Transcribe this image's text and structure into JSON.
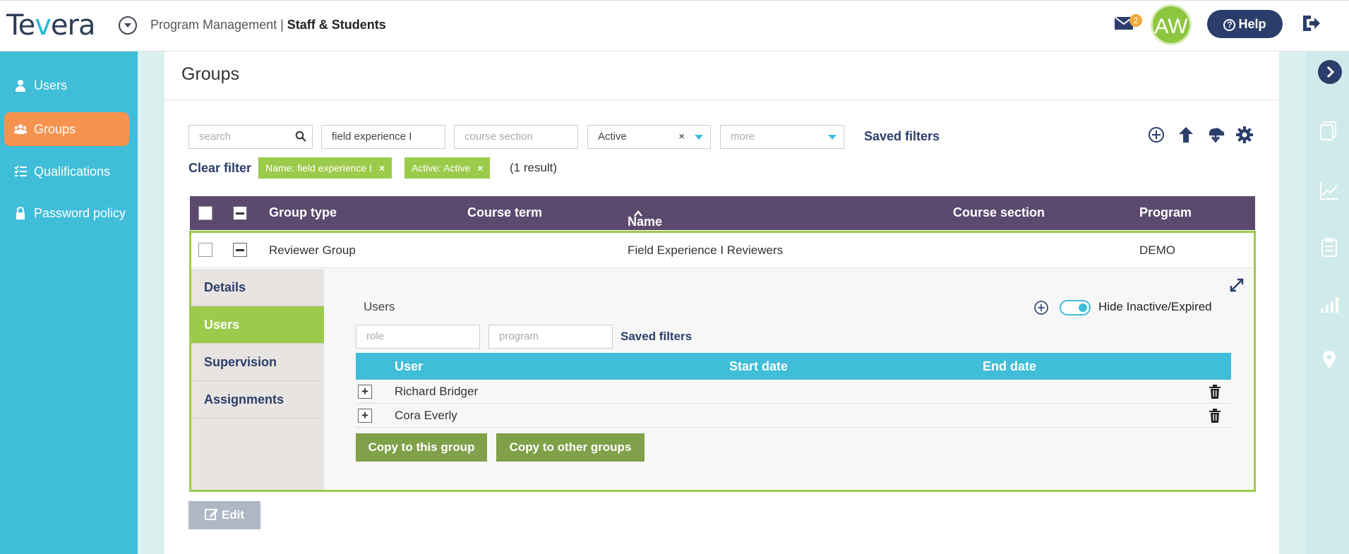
{
  "header": {
    "logo_text_a": "Te",
    "logo_text_v": "v",
    "logo_text_b": "era",
    "breadcrumb_module": "Program Management |",
    "breadcrumb_page": "Staff & Students",
    "mail_count": "2",
    "avatar_initials": "AW",
    "help_label": "Help",
    "help_icon_glyph": "?"
  },
  "sidebar": {
    "items": [
      {
        "label": "Users",
        "icon": "user-icon"
      },
      {
        "label": "Groups",
        "icon": "group-icon",
        "active": true
      },
      {
        "label": "Qualifications",
        "icon": "checklist-icon"
      },
      {
        "label": "Password policy",
        "icon": "lock-icon"
      }
    ]
  },
  "main": {
    "title": "Groups",
    "filters": {
      "search_placeholder": "search",
      "name_value": "field experience I",
      "course_section_placeholder": "course section",
      "status_value": "Active",
      "status_clear": "×",
      "more_placeholder": "more",
      "saved_filters": "Saved filters"
    },
    "clear_filter": "Clear filter",
    "chips": [
      {
        "label": "Name: field experience I"
      },
      {
        "label": "Active: Active"
      }
    ],
    "chip_close": "×",
    "result_count": "(1 result)",
    "table": {
      "columns": [
        "Group type",
        "Course term",
        "Name",
        "Course section",
        "Program"
      ],
      "rows": [
        {
          "group_type": "Reviewer Group",
          "course_term": "",
          "name": "Field Experience I Reviewers",
          "course_section": "",
          "program": "DEMO"
        }
      ]
    },
    "detail": {
      "tabs": [
        "Details",
        "Users",
        "Supervision",
        "Assignments"
      ],
      "active_tab": "Users",
      "users_title": "Users",
      "hide_inactive_label": "Hide Inactive/Expired",
      "role_placeholder": "role",
      "program_placeholder": "program",
      "saved_filters": "Saved filters",
      "columns": [
        "User",
        "Start date",
        "End date"
      ],
      "row_expand_glyph": "+",
      "users": [
        {
          "name": "Richard Bridger",
          "start_date": "",
          "end_date": ""
        },
        {
          "name": "Cora Everly",
          "start_date": "",
          "end_date": ""
        }
      ],
      "copy_to_this_group": "Copy to this group",
      "copy_to_other_groups": "Copy to other groups"
    },
    "edit_label": "Edit"
  },
  "colors": {
    "sidebar_bg": "#3fbdd9",
    "sidebar_active": "#f5934f",
    "table_header": "#5b4a6e",
    "accent_green": "#9ccb4b",
    "button_green": "#80a04a",
    "navy": "#2b3e6b"
  }
}
